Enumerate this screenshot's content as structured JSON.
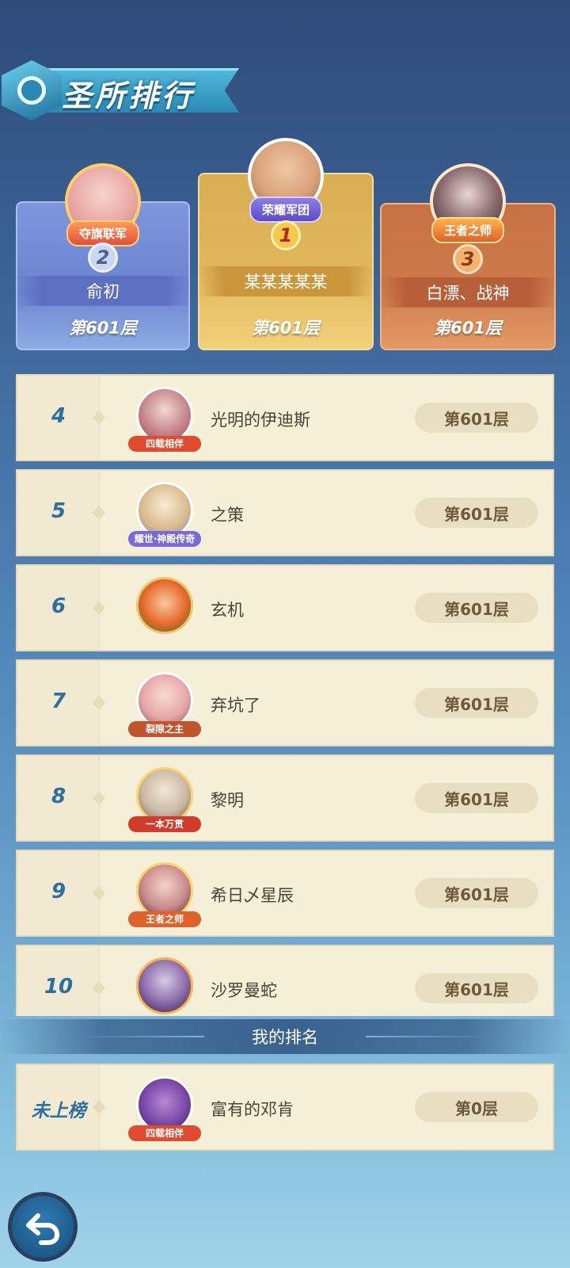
{
  "header": {
    "title": "圣所排行"
  },
  "podium": [
    {
      "rank": "2",
      "badge": "夺旗联军",
      "name": "俞初",
      "floor": "第601层"
    },
    {
      "rank": "1",
      "badge": "荣耀军团",
      "name": "某某某某某",
      "floor": "第601层"
    },
    {
      "rank": "3",
      "badge": "王者之师",
      "name": "白漂、战神",
      "floor": "第601层"
    }
  ],
  "rows": [
    {
      "rank": "4",
      "tag": "四载相伴",
      "name": "光明的伊迪斯",
      "floor": "第601层",
      "tag_color": "#e04a2f"
    },
    {
      "rank": "5",
      "tag": "耀世·神殿传奇",
      "name": "之策",
      "floor": "第601层",
      "tag_color": "#7a6ad8"
    },
    {
      "rank": "6",
      "tag": "",
      "name": "玄机",
      "floor": "第601层",
      "tag_color": "#6aa24a"
    },
    {
      "rank": "7",
      "tag": "裂隙之主",
      "name": "弃坑了",
      "floor": "第601层",
      "tag_color": "#c0542c"
    },
    {
      "rank": "8",
      "tag": "一本万贯",
      "name": "黎明",
      "floor": "第601层",
      "tag_color": "#d23b2a"
    },
    {
      "rank": "9",
      "tag": "王者之师",
      "name": "希日乄星辰",
      "floor": "第601层",
      "tag_color": "#e0622a"
    },
    {
      "rank": "10",
      "tag": "",
      "name": "沙罗曼蛇",
      "floor": "第601层",
      "tag_color": "#4d7fd8"
    }
  ],
  "my_rank": {
    "label": "我的排名",
    "rank": "未上榜",
    "tag": "四载相伴",
    "name": "富有的邓肯",
    "floor": "第0层"
  },
  "icons": {
    "back": "back-arrow-icon",
    "header": "sanctuary-emblem-icon"
  }
}
